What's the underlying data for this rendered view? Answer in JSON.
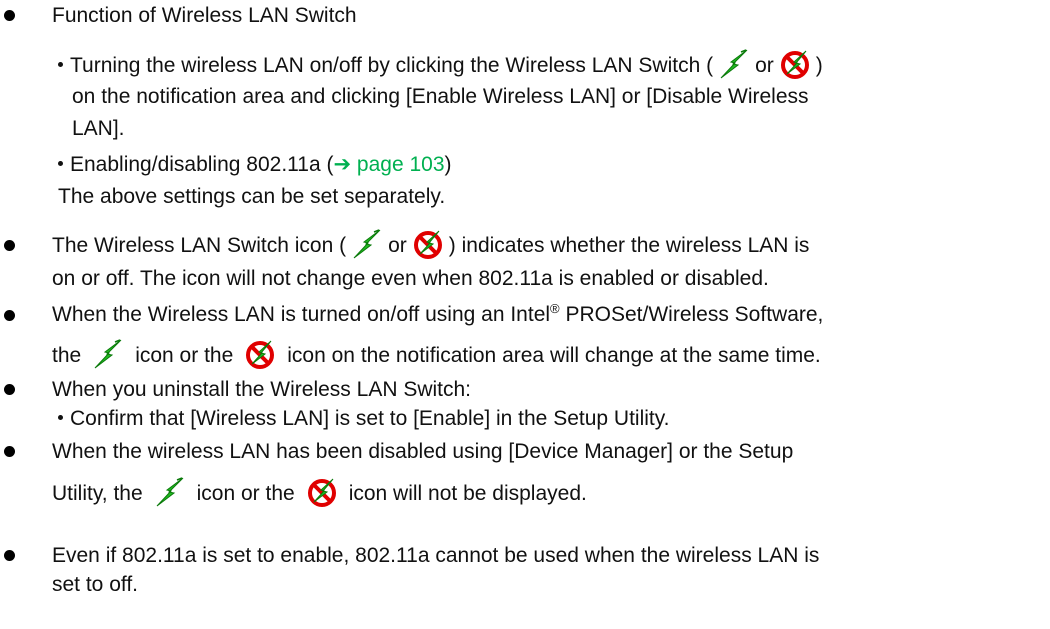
{
  "b1": {
    "title": "Function of Wireless LAN Switch",
    "item1": {
      "pre": "Turning the wireless LAN on/off by clicking the Wireless LAN Switch (",
      "or": "or",
      "post": ")",
      "line2": "on the notification area and clicking [Enable Wireless LAN] or [Disable Wireless",
      "line3": "LAN]."
    },
    "item2": {
      "pre": "Enabling/disabling 802.11a (",
      "link": "page 103",
      "post": ")"
    },
    "note": "The above settings can be set separately."
  },
  "b2": {
    "pre": "The Wireless LAN Switch icon (",
    "or": "or",
    "post": ") indicates whether the wireless LAN is",
    "line2": "on or off. The icon will not change even when 802.11a is enabled or disabled."
  },
  "b3": {
    "pre": "When the Wireless LAN is turned on/off using an Intel",
    "reg": "®",
    "post": " PROSet/Wireless Software,",
    "l2a": "the",
    "l2b": "icon or the",
    "l2c": "icon on the notification area will change at the same time."
  },
  "b4": {
    "title": "When you uninstall the Wireless LAN Switch:",
    "item": "Confirm that [Wireless LAN] is set to [Enable] in the Setup Utility."
  },
  "b5": {
    "line1": "When the wireless LAN has been disabled using [Device Manager] or the Setup",
    "l2a": "Utility, the",
    "l2b": "icon or the",
    "l2c": "icon will not be displayed."
  },
  "b6": {
    "line1": "Even if 802.11a is set to enable, 802.11a cannot be used when the wireless LAN is",
    "line2": "set to off."
  },
  "icons": {
    "on": "wireless-on-lightning-icon",
    "off": "wireless-off-prohibited-icon"
  },
  "colors": {
    "link": "#00b050",
    "text": "#111111"
  }
}
